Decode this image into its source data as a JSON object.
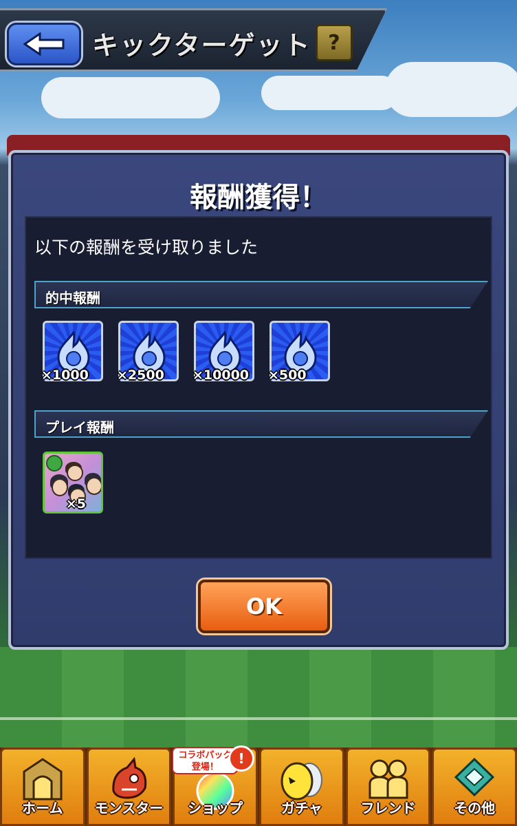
{
  "header": {
    "title": "キックターゲット",
    "help_label": "?"
  },
  "dialog": {
    "title": "報酬獲得！",
    "subtitle": "以下の報酬を受け取りました",
    "hit_section": {
      "label": "的中報酬",
      "rewards": [
        {
          "icon": "blue-flame-icon",
          "quantity": "×1000"
        },
        {
          "icon": "blue-flame-icon",
          "quantity": "×2500"
        },
        {
          "icon": "blue-flame-icon",
          "quantity": "×10000"
        },
        {
          "icon": "blue-flame-icon",
          "quantity": "×500"
        }
      ]
    },
    "play_section": {
      "label": "プレイ報酬",
      "rewards": [
        {
          "icon": "character-portrait",
          "quantity": "×5"
        }
      ]
    },
    "ok_label": "OK"
  },
  "bottom_nav": {
    "items": [
      {
        "label": "ホーム",
        "icon": "gate-icon"
      },
      {
        "label": "モンスター",
        "icon": "dragon-icon"
      },
      {
        "label": "ショップ",
        "icon": "rainbow-orb-icon",
        "badge": "コラボパック\n登場！",
        "alert": "!"
      },
      {
        "label": "ガチャ",
        "icon": "egg-icon"
      },
      {
        "label": "フレンド",
        "icon": "friends-icon"
      },
      {
        "label": "その他",
        "icon": "other-icon"
      }
    ]
  },
  "colors": {
    "accent_orange": "#e85d10",
    "panel_blue": "#303c6c",
    "section_border": "#4fa3c9"
  }
}
